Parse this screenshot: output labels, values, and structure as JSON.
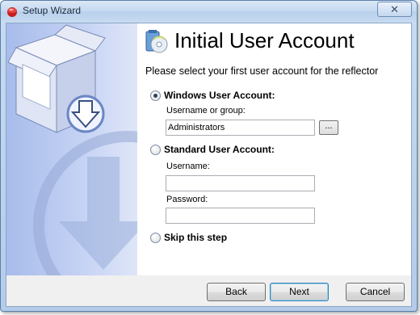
{
  "window": {
    "title": "Setup Wizard",
    "close_label": "✕"
  },
  "header": {
    "title": "Initial User Account",
    "subtitle": "Please select your first user account for the reflector"
  },
  "options": {
    "windows": {
      "label": "Windows User Account:",
      "selected": true
    },
    "username_or_group_label": "Username or group:",
    "username_or_group_value": "Administrators",
    "browse_label": "...",
    "standard": {
      "label": "Standard User Account:",
      "selected": false
    },
    "username_label": "Username:",
    "username_value": "",
    "password_label": "Password:",
    "password_value": "",
    "skip": {
      "label": "Skip this step",
      "selected": false
    }
  },
  "footer": {
    "back_label": "Back",
    "next_label": "Next",
    "cancel_label": "Cancel"
  },
  "colors": {
    "accent": "#3c7fb1",
    "side_panel": "#b6c7ef",
    "title_bar": "#c5d9f0"
  }
}
